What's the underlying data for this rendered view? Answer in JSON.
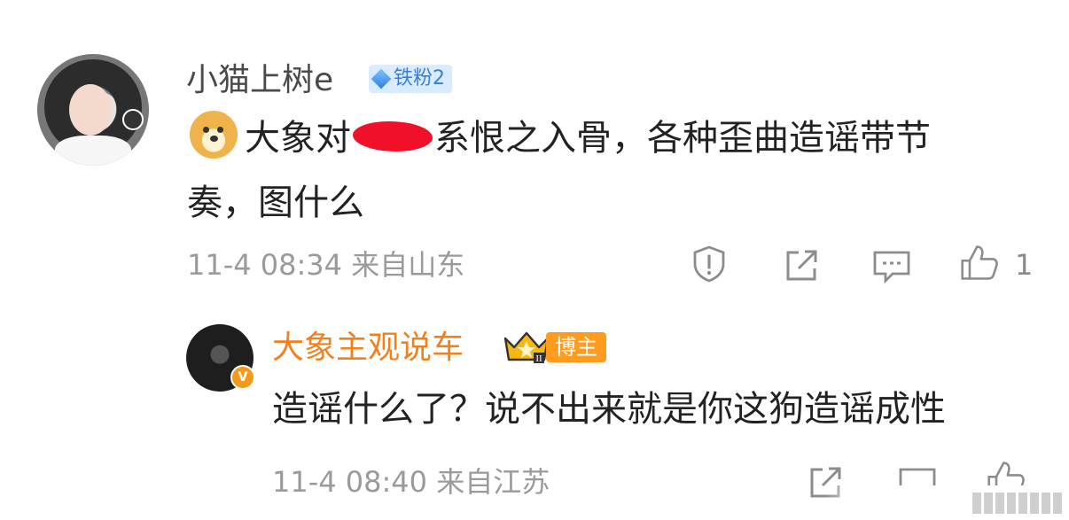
{
  "main_comment": {
    "username": "小猫上树e",
    "fan_badge": "铁粉2",
    "text_before_redaction": "大象对",
    "text_after_redaction": "系恨之入骨，各种歪曲造谣带节",
    "text_line2": "奏，图什么",
    "timestamp": "11-4 08:34",
    "location": "来自山东",
    "like_count": "1"
  },
  "reply": {
    "username": "大象主观说车",
    "role_badge": "博主",
    "crown_mark": "II",
    "verify_mark": "V",
    "text": "造谣什么了？说不出来就是你这狗造谣成性",
    "timestamp": "11-4 08:40",
    "location": "来自江苏"
  },
  "icons": {
    "report": "report-icon",
    "share": "share-icon",
    "comment": "comment-icon",
    "like": "like-icon",
    "emoji": "doge-emoji-icon",
    "crown": "crown-icon",
    "fan": "diamond-icon"
  },
  "colors": {
    "reply_username": "#f2811d",
    "fan_badge_bg": "#d9ecff",
    "fan_badge_text": "#3a7fd6",
    "blogger_badge_bg": "#ff9b1e",
    "meta_text": "#9a9a9a"
  }
}
